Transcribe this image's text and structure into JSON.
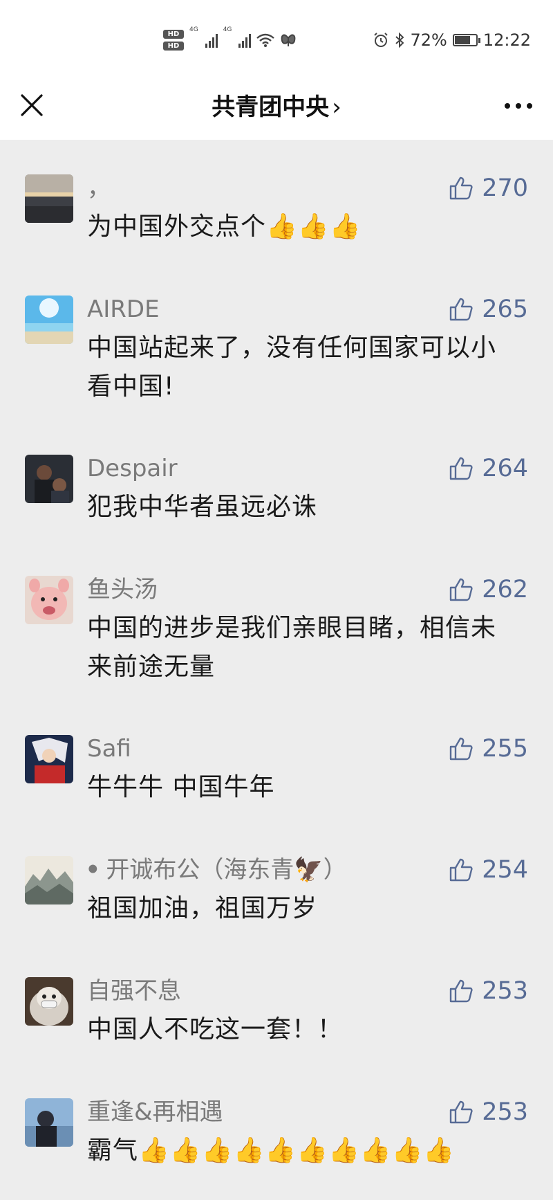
{
  "status_bar": {
    "hd1": "HD",
    "hd2": "HD",
    "sim1_label": "4G",
    "sim2_label": "4G",
    "battery_percent": "72%",
    "battery_level": 0.72,
    "time": "12:22"
  },
  "nav": {
    "title": "共青团中央",
    "chevron": "›",
    "close_icon": "close-icon",
    "more_icon": "more-icon"
  },
  "comments": [
    {
      "name": "，",
      "likes": "270",
      "text": "为中国外交点个👍👍👍",
      "avatar": "sunset-photo"
    },
    {
      "name": "AIRDE",
      "likes": "265",
      "text": "中国站起来了，没有任何国家可以小看中国!",
      "avatar": "beach-photo"
    },
    {
      "name": "Despair",
      "likes": "264",
      "text": "犯我中华者虽远必诛",
      "avatar": "couple-photo"
    },
    {
      "name": "鱼头汤",
      "likes": "262",
      "text": "中国的进步是我们亲眼目睹，相信未来前途无量",
      "avatar": "pig-photo"
    },
    {
      "name": "Safi",
      "likes": "255",
      "text": "牛牛牛  中国牛年",
      "avatar": "anime-photo"
    },
    {
      "name": "ꔷ 开诚布公（海东青🦅）",
      "likes": "254",
      "text": "祖国加油，祖国万岁",
      "avatar": "landscape-painting"
    },
    {
      "name": "自强不息",
      "likes": "253",
      "text": "中国人不吃这一套！！",
      "avatar": "cat-photo"
    },
    {
      "name": "重逢&再相遇",
      "likes": "253",
      "text": "霸气👍👍👍👍👍👍👍👍👍👍",
      "avatar": "man-photo"
    }
  ],
  "colors": {
    "background": "#ededed",
    "link_blue": "#576b95",
    "name_gray": "#7a7a7a"
  }
}
